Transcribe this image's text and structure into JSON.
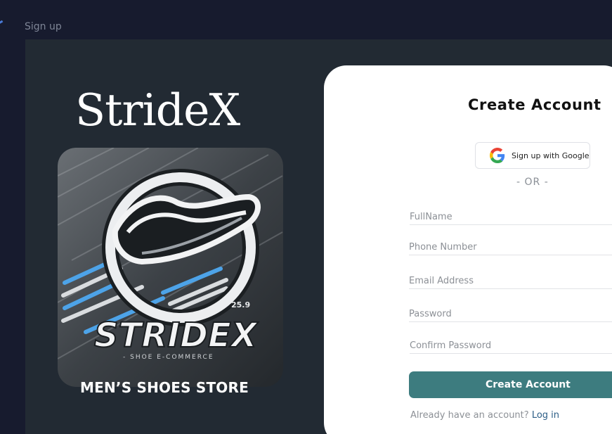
{
  "page": {
    "label": "Sign up"
  },
  "brand": {
    "name": "StrideX",
    "store_title": "MEN’S SHOES STORE"
  },
  "logo": {
    "wordmark": "STRIDEX",
    "tagline": "- SHOE E-COMMERCE",
    "number": "25.9"
  },
  "form": {
    "title": "Create Account",
    "google_label": "Sign up with Google",
    "divider": "- OR -",
    "fields": {
      "fullname": {
        "placeholder": "FullName",
        "value": ""
      },
      "phone": {
        "placeholder": "Phone Number",
        "value": ""
      },
      "email": {
        "placeholder": "Email Address",
        "value": ""
      },
      "password": {
        "placeholder": "Password",
        "value": ""
      },
      "confirm": {
        "placeholder": "Confirm Password",
        "value": ""
      }
    },
    "submit_label": "Create Account",
    "login_prompt": "Already have an account?",
    "login_link": "Log in"
  },
  "colors": {
    "background": "#171b2e",
    "panel": "#222a33",
    "accent": "#3d7c7f",
    "link": "#2b5d86"
  },
  "icons": {
    "google": "google-icon",
    "shoe": "shoe-icon"
  }
}
